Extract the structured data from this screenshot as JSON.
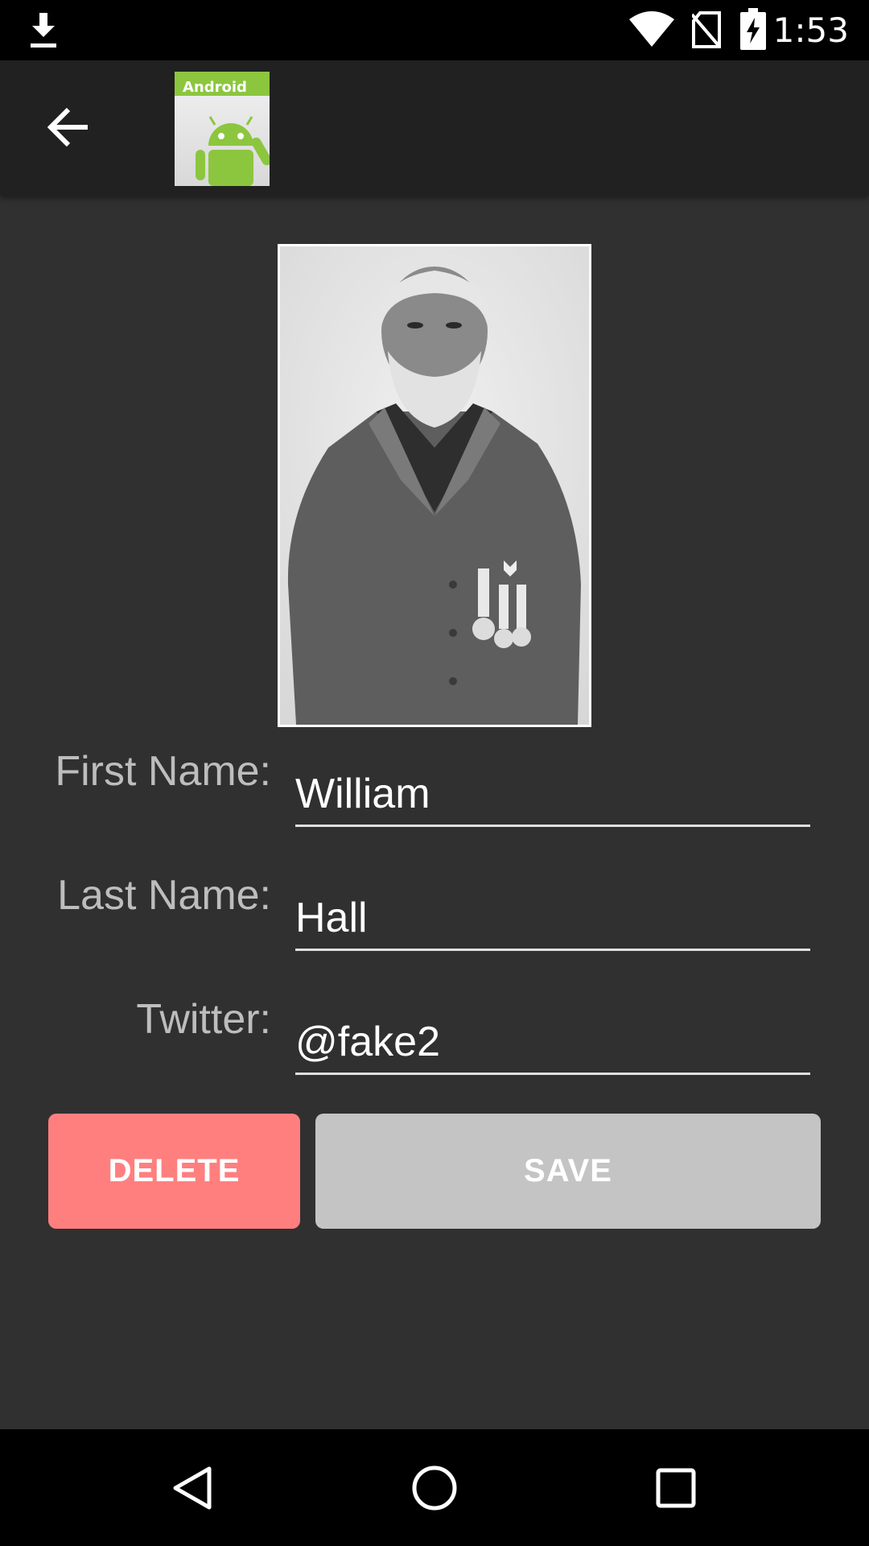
{
  "status_bar": {
    "time": "1:53",
    "icons": [
      "download-icon",
      "wifi-icon",
      "no-sim-icon",
      "battery-charging-icon"
    ]
  },
  "action_bar": {
    "back_icon": "arrow-back-icon",
    "logo_text": "Android"
  },
  "form": {
    "first_name": {
      "label": "First Name:",
      "value": "William"
    },
    "last_name": {
      "label": "Last Name:",
      "value": "Hall"
    },
    "twitter": {
      "label": "Twitter:",
      "value": "@fake2"
    }
  },
  "buttons": {
    "delete_label": "DELETE",
    "save_label": "SAVE"
  },
  "colors": {
    "background": "#303030",
    "action_bar": "#212121",
    "delete": "#ff7f7f",
    "save": "#c4c4c4",
    "label": "#bdbdbd"
  },
  "nav_bar": {
    "icons": [
      "back-triangle-icon",
      "home-circle-icon",
      "recents-square-icon"
    ]
  }
}
